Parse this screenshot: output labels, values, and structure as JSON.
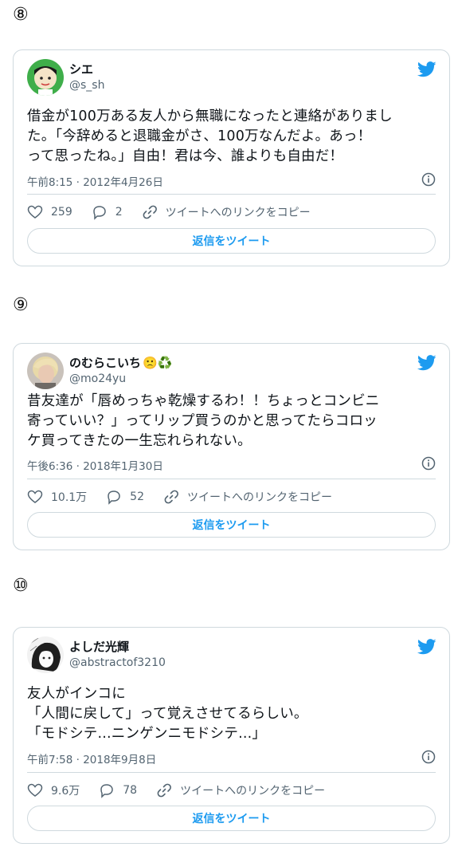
{
  "tweets": [
    {
      "index": "⑧",
      "name": "シエ",
      "handle": "@s_sh",
      "text": "借金が100万ある友人から無職になったと連絡がありまし\nた。「今辞めると退職金がさ、100万なんだよ。あっ！\nって思ったね。」自由！君は今、誰よりも自由だ！",
      "timestamp": "午前8:15 · 2012年4月26日",
      "likes": "259",
      "replies": "2",
      "link_label": "ツイートへのリンクをコピー",
      "reply_button": "返信をツイート"
    },
    {
      "index": "⑨",
      "name": "のむらこいち",
      "name_emoji": "🙁♻️",
      "handle": "@mo24yu",
      "text": "昔友達が「唇めっちゃ乾燥するわ！！ちょっとコンビニ\n寄っていい？」ってリップ買うのかと思ってたらコロッ\nケ買ってきたの一生忘れられない。",
      "timestamp": "午後6:36 · 2018年1月30日",
      "likes": "10.1万",
      "replies": "52",
      "link_label": "ツイートへのリンクをコピー",
      "reply_button": "返信をツイート"
    },
    {
      "index": "⑩",
      "name": "よしだ光輝",
      "handle": "@abstractof3210",
      "text": "友人がインコに\n「人間に戻して」って覚えさせてるらしい。\n「モドシテ...ニンゲンニモドシテ...」",
      "timestamp": "午前7:58 · 2018年9月8日",
      "likes": "9.6万",
      "replies": "78",
      "link_label": "ツイートへのリンクをコピー",
      "reply_button": "返信をツイート"
    }
  ],
  "colors": {
    "accent": "#1d9bf0",
    "secondary_text": "#536471",
    "border": "#cfd9de"
  }
}
